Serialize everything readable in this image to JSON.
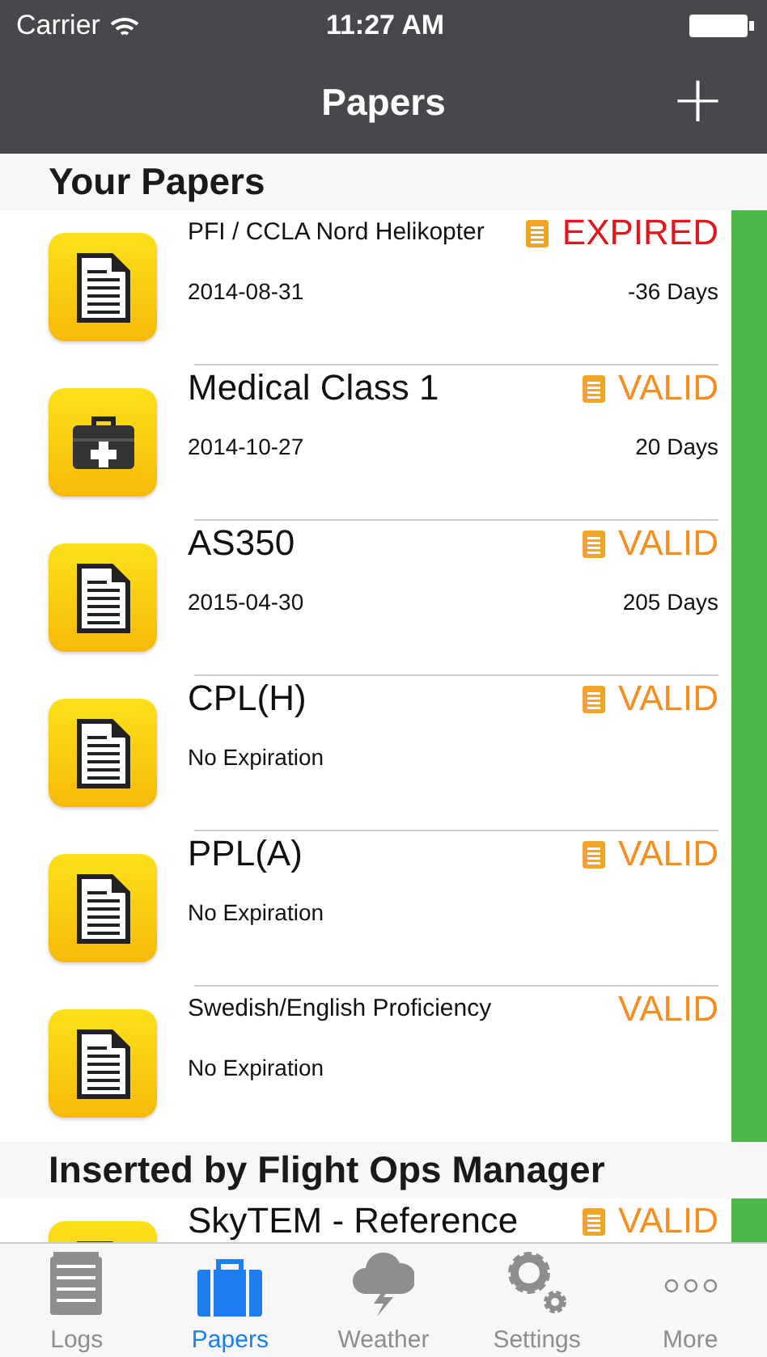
{
  "status_bar": {
    "carrier": "Carrier",
    "time": "11:27 AM"
  },
  "nav": {
    "title": "Papers",
    "add": "+"
  },
  "sections": [
    {
      "title": "Your Papers",
      "rows": [
        {
          "kind": "document",
          "title": "PFI / CCLA Nord Helikopter",
          "compact": true,
          "note": true,
          "status": "EXPIRED",
          "expired": true,
          "date": "2014-08-31",
          "days": "-36 Days"
        },
        {
          "kind": "medical",
          "title": "Medical Class 1",
          "compact": false,
          "note": true,
          "status": "VALID",
          "expired": false,
          "date": "2014-10-27",
          "days": "20 Days"
        },
        {
          "kind": "document",
          "title": "AS350",
          "compact": false,
          "note": true,
          "status": "VALID",
          "expired": false,
          "date": "2015-04-30",
          "days": "205 Days"
        },
        {
          "kind": "document",
          "title": "CPL(H)",
          "compact": false,
          "note": true,
          "status": "VALID",
          "expired": false,
          "date": "No Expiration"
        },
        {
          "kind": "document",
          "title": "PPL(A)",
          "compact": false,
          "note": true,
          "status": "VALID",
          "expired": false,
          "date": "No Expiration"
        },
        {
          "kind": "document",
          "title": "Swedish/English Proficiency",
          "compact": true,
          "note": false,
          "status": "VALID",
          "expired": false,
          "date": "No Expiration"
        }
      ]
    },
    {
      "title": "Inserted by Flight Ops Manager",
      "rows": [
        {
          "kind": "document",
          "title": "SkyTEM - Reference",
          "compact": false,
          "note": true,
          "status": "VALID",
          "expired": false
        }
      ]
    }
  ],
  "tabs": [
    {
      "label": "Logs",
      "kind": "notepad",
      "selected": false
    },
    {
      "label": "Papers",
      "kind": "briefcase",
      "selected": true
    },
    {
      "label": "Weather",
      "kind": "storm",
      "selected": false
    },
    {
      "label": "Settings",
      "kind": "gears",
      "selected": false
    },
    {
      "label": "More",
      "kind": "dots",
      "selected": false
    }
  ]
}
